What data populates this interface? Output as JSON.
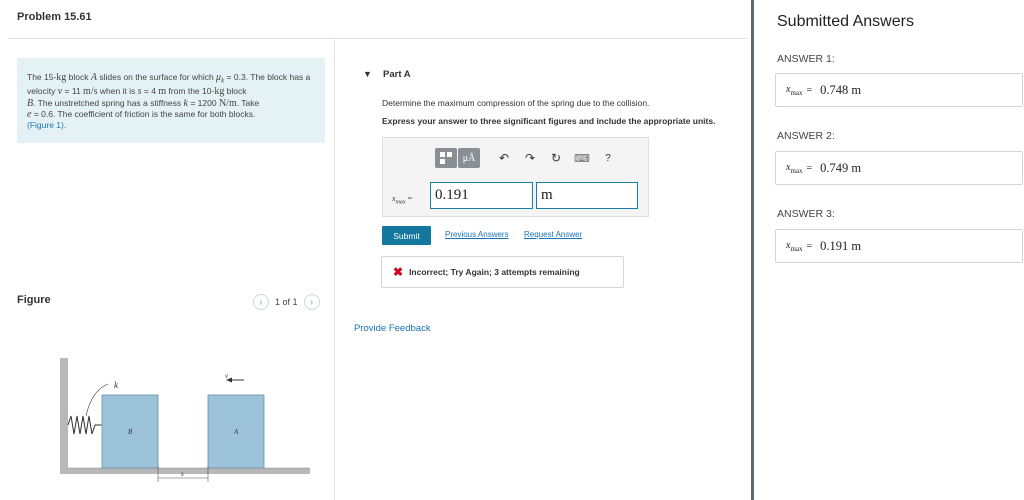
{
  "problem": {
    "title": "Problem 15.61"
  },
  "statement": {
    "t1": "The 15-",
    "kg1": "kg",
    "t2": " block ",
    "A": "A",
    "t3": " slides on the surface for which ",
    "mu": "μ",
    "muk": "k",
    "t4": " = 0.3. The block has a velocity ",
    "v": "v",
    "t5": " = 11 ",
    "ms": "m/s",
    "t6": " when it is ",
    "s": "s",
    "t7": " = 4 ",
    "m1": "m",
    "t8": " from the 10-",
    "kg2": "kg",
    "t9": " block ",
    "B": "B",
    "t10": ". The unstretched spring has a stiffness ",
    "k": "k",
    "t11": " = 1200 ",
    "Nm": "N/m",
    "t12": ". Take ",
    "e": "e",
    "t13": " = 0.6. The coefficient of friction is the same for both blocks.",
    "figure_link": "(Figure 1)",
    "t14": "."
  },
  "figure": {
    "label": "Figure",
    "pager_text": "1 of 1",
    "k_label": "k",
    "v_label": "v",
    "block_b": "B",
    "block_a": "A",
    "s_label": "s",
    "colors": {
      "block": "#9cc3d9",
      "block_border": "#6b8fa5"
    }
  },
  "part": {
    "toggle": "▼",
    "title": "Part A",
    "question": "Determine the maximum compression of the spring due to the collision.",
    "instruction": "Express your answer to three significant figures and include the appropriate units.",
    "toolbar": {
      "mu_label": "μÅ",
      "undo": "↶",
      "redo": "↷",
      "reset": "↻",
      "keyboard": "⌨",
      "help": "?"
    },
    "answer_var": "x",
    "answer_sub": "max",
    "answer_eq": " =",
    "value": "0.191",
    "unit": "m",
    "submit": "Submit",
    "previous_answers": "Previous Answers",
    "request_answer": "Request Answer",
    "feedback_icon": "✖",
    "feedback": "Incorrect; Try Again; 3 attempts remaining",
    "provide_feedback": "Provide Feedback"
  },
  "submitted": {
    "title": "Submitted Answers",
    "answers": [
      {
        "label": "ANSWER 1:",
        "var": "x",
        "sub": "max",
        "eq": "=",
        "value": "0.748 m"
      },
      {
        "label": "ANSWER 2:",
        "var": "x",
        "sub": "max",
        "eq": "=",
        "value": "0.749 m"
      },
      {
        "label": "ANSWER 3:",
        "var": "x",
        "sub": "max",
        "eq": "=",
        "value": "0.191 m"
      }
    ],
    "colors": {
      "divider": "#5a6a78"
    }
  }
}
